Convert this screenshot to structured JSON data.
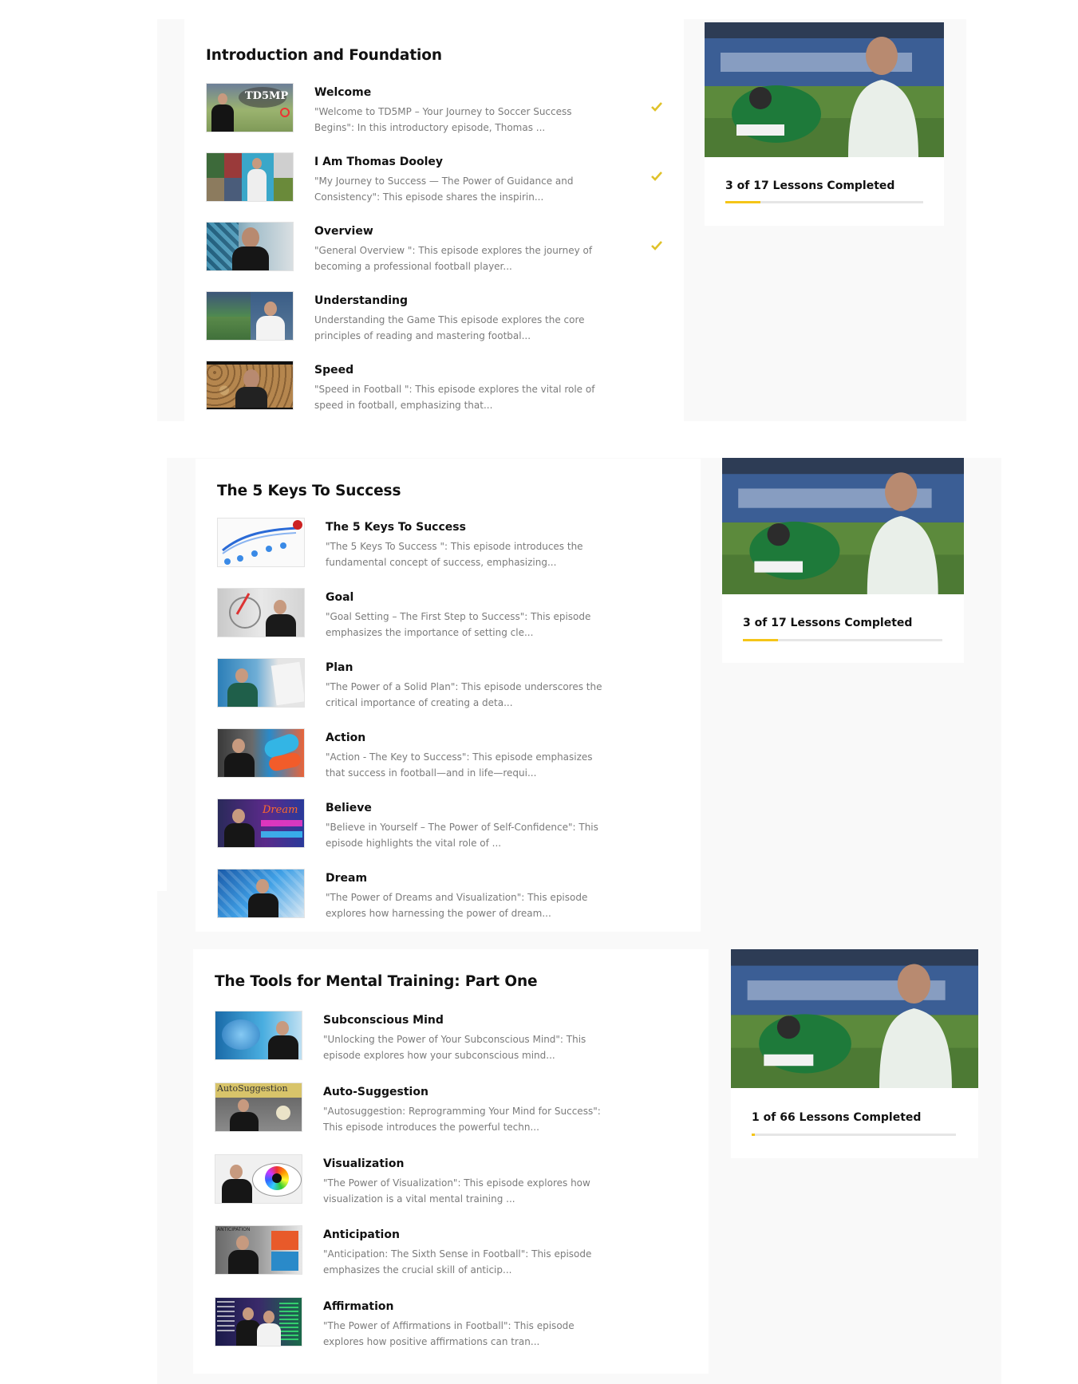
{
  "accent_color": "#f5c518",
  "courses": [
    {
      "title": "Introduction and Foundation",
      "progress": {
        "label": "3 of 17 Lessons Completed",
        "completed": 3,
        "total": 17
      },
      "lessons": [
        {
          "title": "Welcome",
          "description": "\"Welcome to TD5MP – Your Journey to Soccer Success Begins\": In this introductory episode, Thomas ...",
          "completed": true,
          "thumb_icon": "td5mp-logo-thumbnail"
        },
        {
          "title": "I Am Thomas Dooley",
          "description": "\"My Journey to Success — The Power of Guidance and Consistency\": This episode shares the inspirin...",
          "completed": true,
          "thumb_icon": "collage-thumbnail"
        },
        {
          "title": "Overview",
          "description": "\"General Overview \": This episode explores the journey of becoming a professional football player...",
          "completed": true,
          "thumb_icon": "presenter-thumbnail"
        },
        {
          "title": "Understanding",
          "description": "Understanding the Game This episode explores the core principles of reading and mastering footbal...",
          "completed": false,
          "thumb_icon": "stadium-thumbnail"
        },
        {
          "title": "Speed",
          "description": "\"Speed in Football \": This episode explores the vital role of speed in football, emphasizing that...",
          "completed": false,
          "thumb_icon": "cheetah-thumbnail"
        }
      ]
    },
    {
      "title": "The 5 Keys To Success",
      "progress": {
        "label": "3 of 17 Lessons Completed",
        "completed": 3,
        "total": 17
      },
      "lessons": [
        {
          "title": "The 5 Keys To Success",
          "description": "\"The 5 Keys To Success \": This episode introduces the fundamental concept of success, emphasizing...",
          "completed": false,
          "thumb_icon": "keys-diagram-thumbnail"
        },
        {
          "title": "Goal",
          "description": "\"Goal Setting – The First Step to Success\": This episode emphasizes the importance of setting cle...",
          "completed": false,
          "thumb_icon": "compass-thumbnail"
        },
        {
          "title": "Plan",
          "description": "\"The Power of a Solid Plan\": This episode underscores the critical importance of creating a deta...",
          "completed": false,
          "thumb_icon": "plan-thumbnail"
        },
        {
          "title": "Action",
          "description": "\"Action - The Key to Success\": This episode emphasizes that success in football—and in life—requi...",
          "completed": false,
          "thumb_icon": "boots-thumbnail"
        },
        {
          "title": "Believe",
          "description": "\"Believe in Yourself – The Power of Self-Confidence\": This episode highlights the vital role of ...",
          "completed": false,
          "thumb_icon": "neon-sign-thumbnail"
        },
        {
          "title": "Dream",
          "description": "\"The Power of Dreams and Visualization\": This episode explores how harnessing the power of dream...",
          "completed": false,
          "thumb_icon": "dream-thumbnail"
        }
      ]
    },
    {
      "title": "The Tools for Mental Training: Part One",
      "progress": {
        "label": "1 of 66 Lessons Completed",
        "completed": 1,
        "total": 66
      },
      "lessons": [
        {
          "title": "Subconscious Mind",
          "description": "\"Unlocking the Power of Your Subconscious Mind\": This episode explores how your subconscious mind...",
          "completed": false,
          "thumb_icon": "mind-thumbnail"
        },
        {
          "title": "Auto-Suggestion",
          "description": "\"Autosuggestion: Reprogramming Your Mind for Success\": This episode introduces the powerful techn...",
          "completed": false,
          "thumb_icon": "autosuggestion-thumbnail"
        },
        {
          "title": "Visualization",
          "description": "\"The Power of Visualization\": This episode explores how visualization is a vital mental training ...",
          "completed": false,
          "thumb_icon": "eye-thumbnail"
        },
        {
          "title": "Anticipation",
          "description": "\"Anticipation: The Sixth Sense in Football\": This episode emphasizes the crucial skill of anticip...",
          "completed": false,
          "thumb_icon": "anticipation-thumbnail"
        },
        {
          "title": "Affirmation",
          "description": "\"The Power of Affirmations in Football\": This episode explores how positive affirmations can tran...",
          "completed": false,
          "thumb_icon": "affirmation-thumbnail"
        }
      ]
    }
  ]
}
